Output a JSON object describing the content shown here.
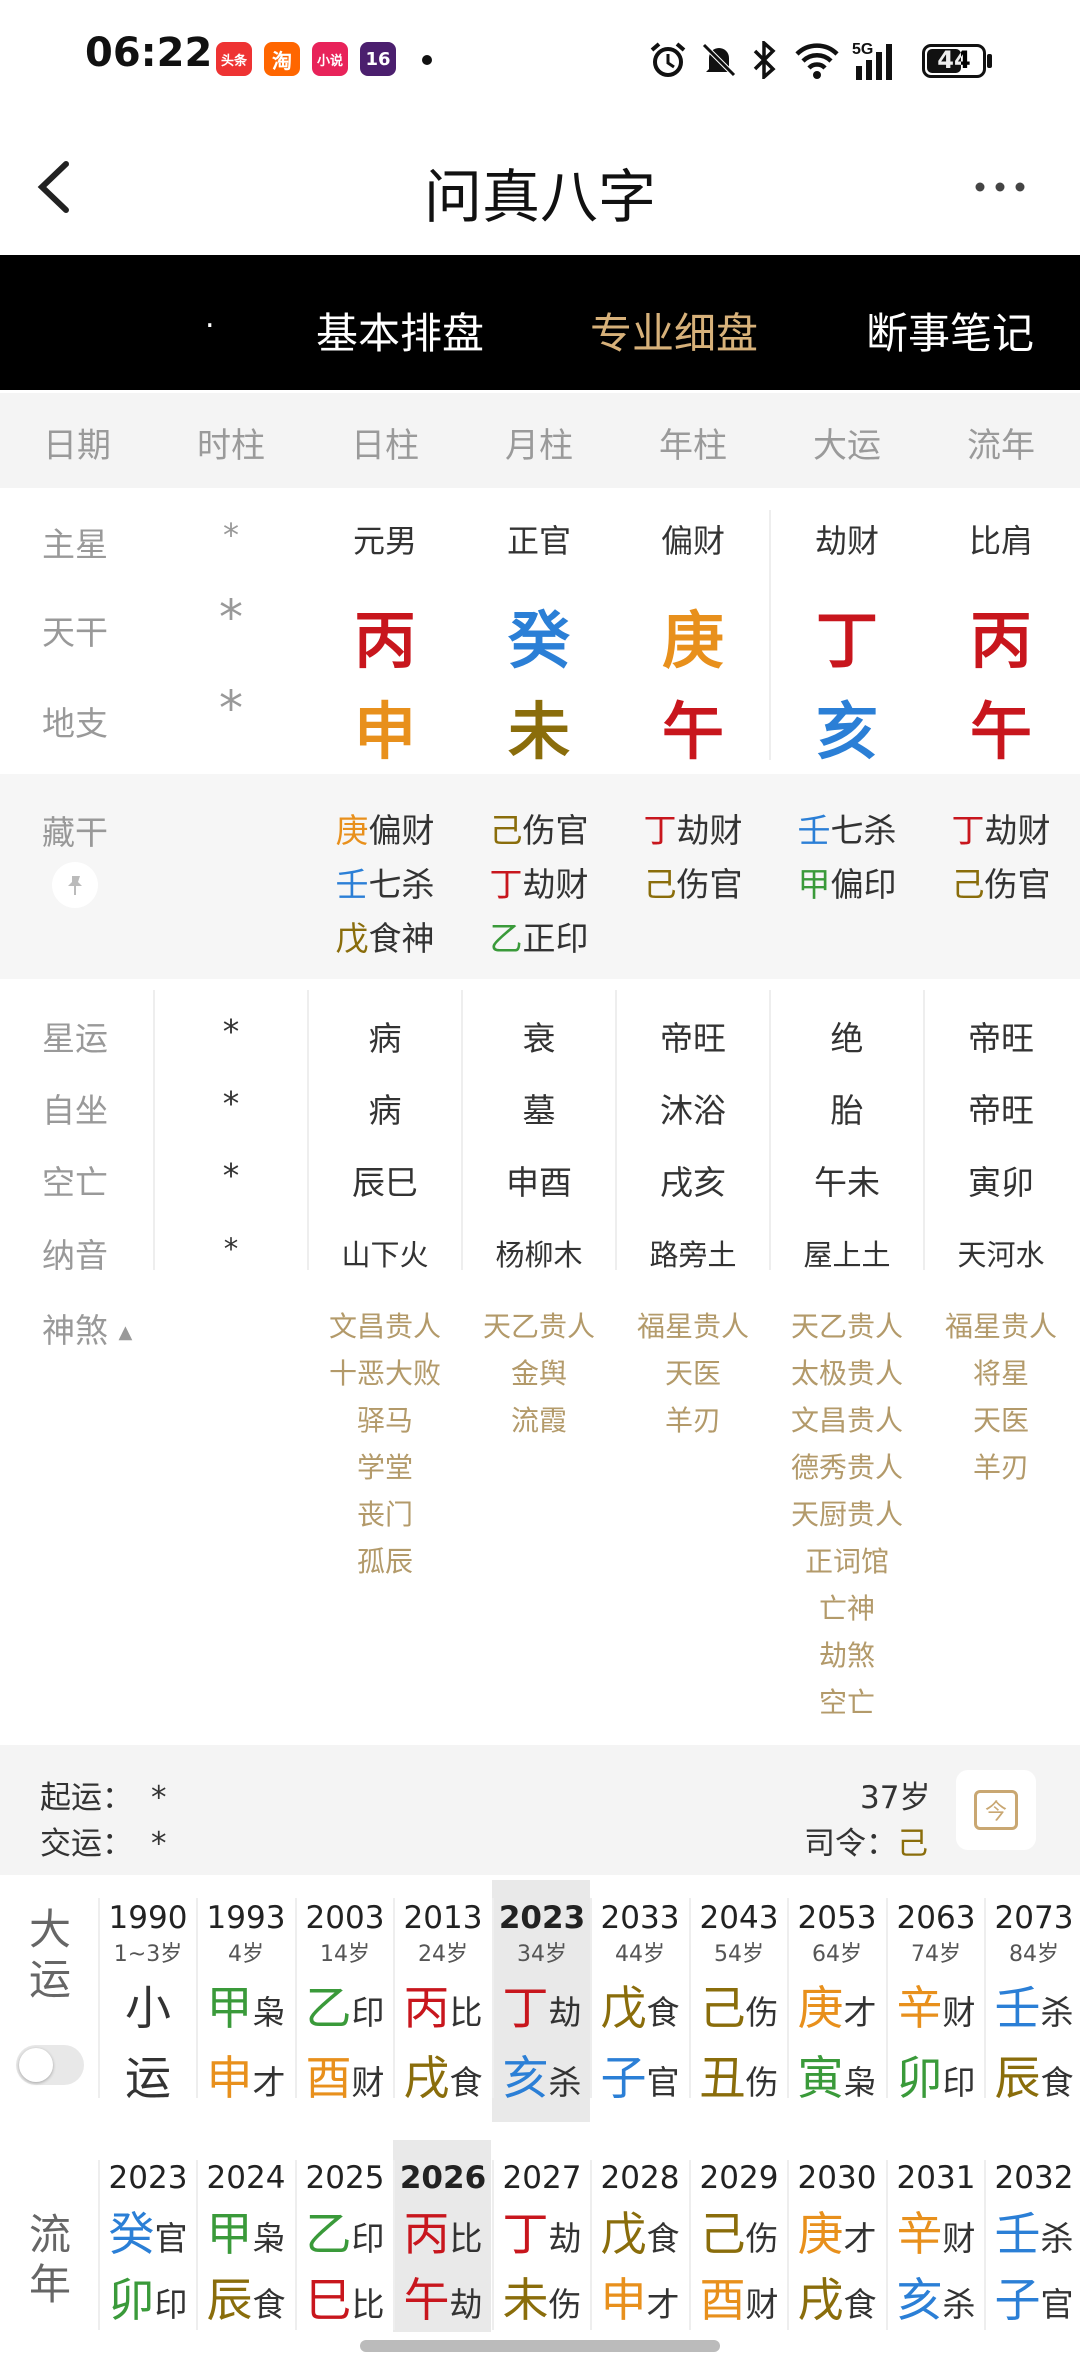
{
  "status": {
    "time": "06:22",
    "badges": [
      "头条",
      "淘",
      "小说",
      "16"
    ],
    "battery": "44"
  },
  "header": {
    "title": "问真八字"
  },
  "tabs": [
    {
      "label": "."
    },
    {
      "label": "基本排盘"
    },
    {
      "label": "专业细盘"
    },
    {
      "label": "断事笔记"
    }
  ],
  "columns": [
    "日期",
    "时柱",
    "日柱",
    "月柱",
    "年柱",
    "大运",
    "流年"
  ],
  "row_labels": {
    "zhuxing": "主星",
    "tiangan": "天干",
    "dizhi": "地支",
    "canggan": "藏干",
    "xingyun": "星运",
    "zizuo": "自坐",
    "kongwang": "空亡",
    "nayin": "纳音",
    "shensha": "神煞"
  },
  "zhuxing": [
    "*",
    "元男",
    "正官",
    "偏财",
    "劫财",
    "比肩"
  ],
  "tiangan": [
    {
      "t": "*",
      "c": "#999999"
    },
    {
      "t": "丙",
      "c": "#c8161d"
    },
    {
      "t": "癸",
      "c": "#2b7fd6"
    },
    {
      "t": "庚",
      "c": "#e8901c"
    },
    {
      "t": "丁",
      "c": "#c8161d"
    },
    {
      "t": "丙",
      "c": "#c8161d"
    }
  ],
  "dizhi": [
    {
      "t": "*",
      "c": "#999999"
    },
    {
      "t": "申",
      "c": "#e8901c"
    },
    {
      "t": "未",
      "c": "#8a6d0b"
    },
    {
      "t": "午",
      "c": "#c8161d"
    },
    {
      "t": "亥",
      "c": "#2b7fd6"
    },
    {
      "t": "午",
      "c": "#c8161d"
    }
  ],
  "canggan": [
    [],
    [
      {
        "g": "庚",
        "gc": "#e8901c",
        "s": "偏财"
      },
      {
        "g": "壬",
        "gc": "#2b7fd6",
        "s": "七杀"
      },
      {
        "g": "戊",
        "gc": "#8a6d0b",
        "s": "食神"
      }
    ],
    [
      {
        "g": "己",
        "gc": "#8a6d0b",
        "s": "伤官"
      },
      {
        "g": "丁",
        "gc": "#c8161d",
        "s": "劫财"
      },
      {
        "g": "乙",
        "gc": "#3a9a3a",
        "s": "正印"
      }
    ],
    [
      {
        "g": "丁",
        "gc": "#c8161d",
        "s": "劫财"
      },
      {
        "g": "己",
        "gc": "#8a6d0b",
        "s": "伤官"
      }
    ],
    [
      {
        "g": "壬",
        "gc": "#2b7fd6",
        "s": "七杀"
      },
      {
        "g": "甲",
        "gc": "#3a9a3a",
        "s": "偏印"
      }
    ],
    [
      {
        "g": "丁",
        "gc": "#c8161d",
        "s": "劫财"
      },
      {
        "g": "己",
        "gc": "#8a6d0b",
        "s": "伤官"
      }
    ]
  ],
  "xingyun": [
    "*",
    "病",
    "衰",
    "帝旺",
    "绝",
    "帝旺"
  ],
  "zizuo": [
    "*",
    "病",
    "墓",
    "沐浴",
    "胎",
    "帝旺"
  ],
  "kongwang": [
    "*",
    "辰巳",
    "申酉",
    "戌亥",
    "午未",
    "寅卯"
  ],
  "nayin": [
    "*",
    "山下火",
    "杨柳木",
    "路旁土",
    "屋上土",
    "天河水"
  ],
  "shensha": [
    [],
    [
      "文昌贵人",
      "十恶大败",
      "驿马",
      "学堂",
      "丧门",
      "孤辰"
    ],
    [
      "天乙贵人",
      "金舆",
      "流霞"
    ],
    [
      "福星贵人",
      "天医",
      "羊刃"
    ],
    [
      "天乙贵人",
      "太极贵人",
      "文昌贵人",
      "德秀贵人",
      "天厨贵人",
      "正词馆",
      "亡神",
      "劫煞",
      "空亡"
    ],
    [
      "福星贵人",
      "将星",
      "天医",
      "羊刃"
    ]
  ],
  "qiyun": {
    "label1": "起运：",
    "val1": "*",
    "label2": "交运：",
    "val2": "*",
    "age": "37岁",
    "siling_label": "司令：",
    "siling": "己",
    "today_icon": "今"
  },
  "dayun": {
    "label": [
      "大",
      "运"
    ],
    "items": [
      {
        "year": "1990",
        "age": "1~3岁",
        "g": "小",
        "gc": "#333333",
        "gs": "",
        "z": "运",
        "zc": "#333333",
        "zs": ""
      },
      {
        "year": "1993",
        "age": "4岁",
        "g": "甲",
        "gc": "#3a9a3a",
        "gs": "枭",
        "z": "申",
        "zc": "#e8901c",
        "zs": "才"
      },
      {
        "year": "2003",
        "age": "14岁",
        "g": "乙",
        "gc": "#3a9a3a",
        "gs": "印",
        "z": "酉",
        "zc": "#e8901c",
        "zs": "财"
      },
      {
        "year": "2013",
        "age": "24岁",
        "g": "丙",
        "gc": "#c8161d",
        "gs": "比",
        "z": "戌",
        "zc": "#8a6d0b",
        "zs": "食"
      },
      {
        "year": "2023",
        "age": "34岁",
        "g": "丁",
        "gc": "#c8161d",
        "gs": "劫",
        "z": "亥",
        "zc": "#2b7fd6",
        "zs": "杀",
        "sel": true
      },
      {
        "year": "2033",
        "age": "44岁",
        "g": "戊",
        "gc": "#8a6d0b",
        "gs": "食",
        "z": "子",
        "zc": "#2b7fd6",
        "zs": "官"
      },
      {
        "year": "2043",
        "age": "54岁",
        "g": "己",
        "gc": "#8a6d0b",
        "gs": "伤",
        "z": "丑",
        "zc": "#8a6d0b",
        "zs": "伤"
      },
      {
        "year": "2053",
        "age": "64岁",
        "g": "庚",
        "gc": "#e8901c",
        "gs": "才",
        "z": "寅",
        "zc": "#3a9a3a",
        "zs": "枭"
      },
      {
        "year": "2063",
        "age": "74岁",
        "g": "辛",
        "gc": "#e8901c",
        "gs": "财",
        "z": "卯",
        "zc": "#3a9a3a",
        "zs": "印"
      },
      {
        "year": "2073",
        "age": "84岁",
        "g": "壬",
        "gc": "#2b7fd6",
        "gs": "杀",
        "z": "辰",
        "zc": "#8a6d0b",
        "zs": "食"
      }
    ]
  },
  "liunian": {
    "label": [
      "流",
      "年"
    ],
    "items": [
      {
        "year": "2023",
        "g": "癸",
        "gc": "#2b7fd6",
        "gs": "官",
        "z": "卯",
        "zc": "#3a9a3a",
        "zs": "印"
      },
      {
        "year": "2024",
        "g": "甲",
        "gc": "#3a9a3a",
        "gs": "枭",
        "z": "辰",
        "zc": "#8a6d0b",
        "zs": "食"
      },
      {
        "year": "2025",
        "g": "乙",
        "gc": "#3a9a3a",
        "gs": "印",
        "z": "巳",
        "zc": "#c8161d",
        "zs": "比"
      },
      {
        "year": "2026",
        "g": "丙",
        "gc": "#c8161d",
        "gs": "比",
        "z": "午",
        "zc": "#c8161d",
        "zs": "劫",
        "sel": true
      },
      {
        "year": "2027",
        "g": "丁",
        "gc": "#c8161d",
        "gs": "劫",
        "z": "未",
        "zc": "#8a6d0b",
        "zs": "伤"
      },
      {
        "year": "2028",
        "g": "戊",
        "gc": "#8a6d0b",
        "gs": "食",
        "z": "申",
        "zc": "#e8901c",
        "zs": "才"
      },
      {
        "year": "2029",
        "g": "己",
        "gc": "#8a6d0b",
        "gs": "伤",
        "z": "酉",
        "zc": "#e8901c",
        "zs": "财"
      },
      {
        "year": "2030",
        "g": "庚",
        "gc": "#e8901c",
        "gs": "才",
        "z": "戌",
        "zc": "#8a6d0b",
        "zs": "食"
      },
      {
        "year": "2031",
        "g": "辛",
        "gc": "#e8901c",
        "gs": "财",
        "z": "亥",
        "zc": "#2b7fd6",
        "zs": "杀"
      },
      {
        "year": "2032",
        "g": "壬",
        "gc": "#2b7fd6",
        "gs": "杀",
        "z": "子",
        "zc": "#2b7fd6",
        "zs": "官"
      }
    ]
  }
}
